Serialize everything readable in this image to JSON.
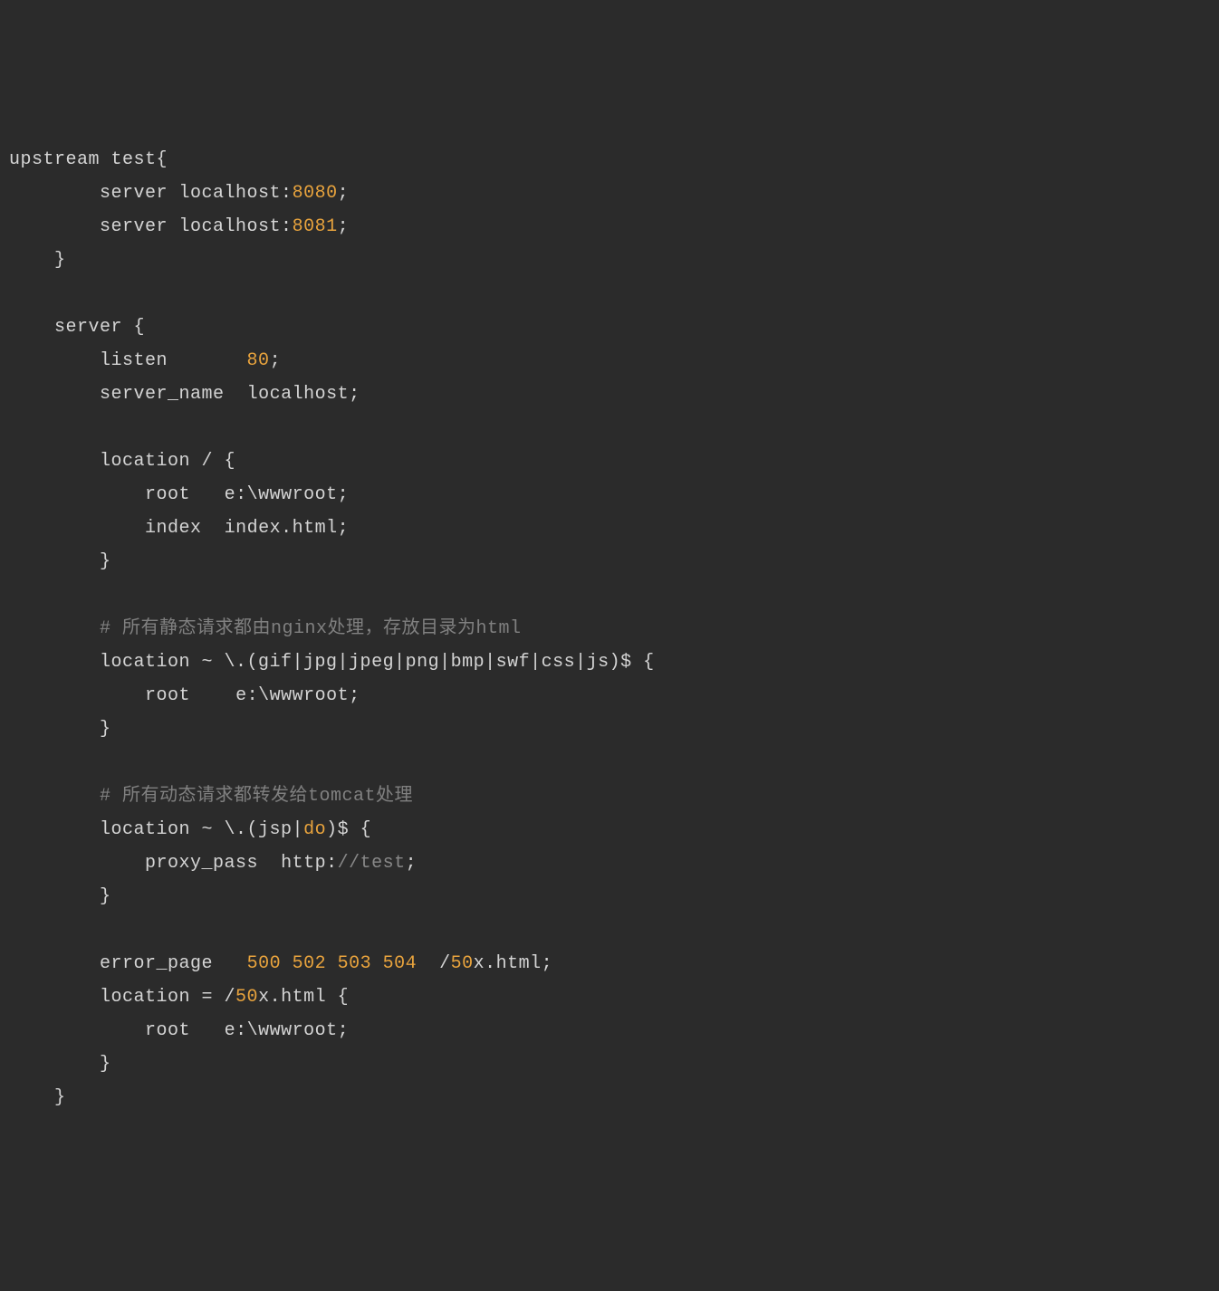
{
  "code": {
    "upstream_name": "test",
    "upstream_server1_host": "server localhost:",
    "upstream_server1_port": "8080",
    "upstream_server2_host": "server localhost:",
    "upstream_server2_port": "8081",
    "server_keyword": "server",
    "listen_keyword": "listen",
    "listen_port": "80",
    "server_name_keyword": "server_name",
    "server_name_value": "localhost",
    "location_root_keyword": "location / {",
    "root_keyword": "root",
    "root_value": "e:\\wwwroot",
    "index_keyword": "index",
    "index_value": "index.html",
    "comment1": "# 所有静态请求都由nginx处理，存放目录为html",
    "location_static": "location ~ \\.(gif|jpg|jpeg|png|bmp|swf|css|js)$ {",
    "comment2": "# 所有动态请求都转发给tomcat处理",
    "location_dynamic_prefix": "location ~ \\.(jsp|",
    "location_dynamic_do": "do",
    "location_dynamic_suffix": ")$ {",
    "proxy_pass_keyword": "proxy_pass",
    "proxy_pass_http": "http:",
    "proxy_pass_path": "//test",
    "error_page_keyword": "error_page",
    "error_codes": "500 502 503 504",
    "error_page_slash": "/",
    "error_page_50": "50",
    "error_page_xhtml": "x.html",
    "location_error_prefix": "location = /",
    "location_error_50": "50",
    "location_error_suffix": "x.html {",
    "upstream_keyword": "upstream",
    "semicolon": ";",
    "open_brace": "{",
    "close_brace": "}"
  }
}
